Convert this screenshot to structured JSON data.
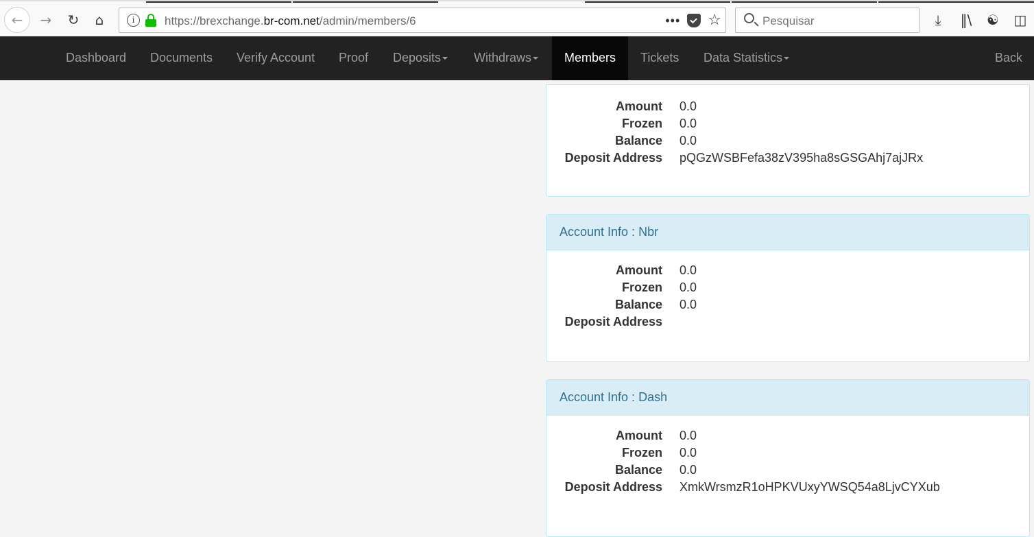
{
  "browser": {
    "url_prefix": "https://brexchange.",
    "url_host": "br-com.net",
    "url_suffix": "/admin/members/6",
    "url_dots": "•••",
    "search_placeholder": "Pesquisar"
  },
  "navbar": {
    "items": [
      {
        "label": "Dashboard"
      },
      {
        "label": "Documents"
      },
      {
        "label": "Verify Account"
      },
      {
        "label": "Proof"
      },
      {
        "label": "Deposits"
      },
      {
        "label": "Withdraws"
      },
      {
        "label": "Members"
      },
      {
        "label": "Tickets"
      },
      {
        "label": "Data Statistics"
      }
    ],
    "back_label": "Back"
  },
  "panels": [
    {
      "rows": [
        {
          "label": "Amount",
          "value": "0.0"
        },
        {
          "label": "Frozen",
          "value": "0.0"
        },
        {
          "label": "Balance",
          "value": "0.0"
        },
        {
          "label": "Deposit Address",
          "value": "pQGzWSBFefa38zV395ha8sGSGAhj7ajJRx"
        }
      ]
    },
    {
      "title": "Account Info : Nbr",
      "rows": [
        {
          "label": "Amount",
          "value": "0.0"
        },
        {
          "label": "Frozen",
          "value": "0.0"
        },
        {
          "label": "Balance",
          "value": "0.0"
        },
        {
          "label": "Deposit Address",
          "value": ""
        }
      ]
    },
    {
      "title": "Account Info : Dash",
      "rows": [
        {
          "label": "Amount",
          "value": "0.0"
        },
        {
          "label": "Frozen",
          "value": "0.0"
        },
        {
          "label": "Balance",
          "value": "0.0"
        },
        {
          "label": "Deposit Address",
          "value": "XmkWrsmzR1oHPKVUxyYWSQ54a8LjvCYXub"
        }
      ]
    }
  ],
  "colors": {
    "navbar_bg": "#222222",
    "navbar_active_bg": "#080808",
    "panel_heading_bg": "#d9edf7",
    "panel_heading_text": "#31708f",
    "panel_border": "#bce8f1"
  }
}
